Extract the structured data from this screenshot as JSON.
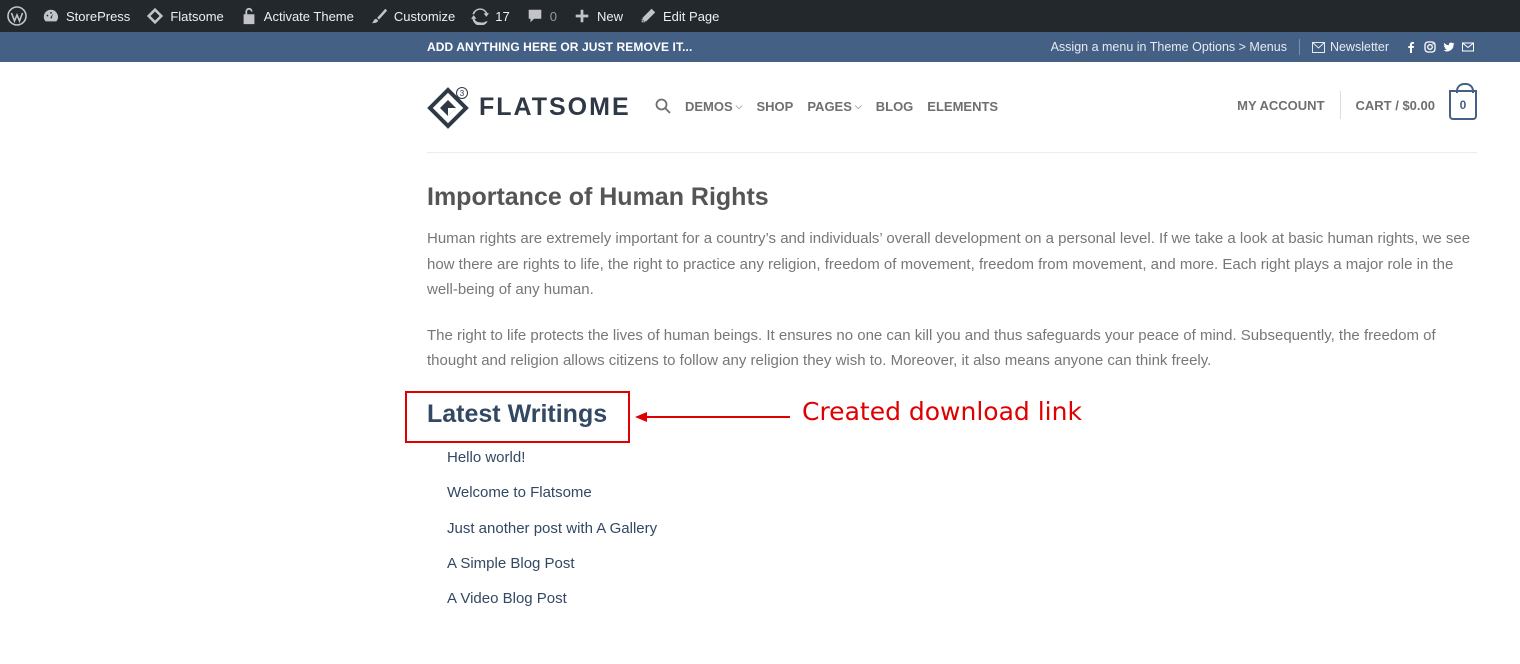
{
  "adminbar": {
    "site_name": "StorePress",
    "theme": "Flatsome",
    "activate": "Activate Theme",
    "customize": "Customize",
    "updates_count": "17",
    "comments_count": "0",
    "new": "New",
    "edit_page": "Edit Page"
  },
  "topbar": {
    "left_text": "ADD ANYTHING HERE OR JUST REMOVE IT...",
    "menu_hint": "Assign a menu in Theme Options > Menus",
    "newsletter": "Newsletter"
  },
  "header": {
    "logo_text": "FLATSOME",
    "logo_badge": "3",
    "nav": [
      {
        "label": "DEMOS",
        "dropdown": true
      },
      {
        "label": "SHOP",
        "dropdown": false
      },
      {
        "label": "PAGES",
        "dropdown": true
      },
      {
        "label": "BLOG",
        "dropdown": false
      },
      {
        "label": "ELEMENTS",
        "dropdown": false
      }
    ],
    "my_account": "MY ACCOUNT",
    "cart_label": "CART / $0.00",
    "cart_count": "0"
  },
  "content": {
    "title": "Importance of Human Rights",
    "paragraphs": [
      "Human rights are extremely important for a country’s and individuals’ overall development on a personal level. If we take a look at basic human rights, we see how there are rights to life, the right to practice any religion, freedom of movement, freedom from movement, and more. Each right plays a major role in the well-being of any human.",
      "The right to life protects the lives of human beings. It ensures no one can kill you and thus safeguards your peace of mind. Subsequently, the freedom of thought and religion allows citizens to follow any religion they wish to. Moreover, it also means anyone can think freely."
    ],
    "latest_title": "Latest Writings",
    "posts": [
      "Hello world!",
      "Welcome to Flatsome",
      "Just another post with A Gallery",
      "A Simple Blog Post",
      "A Video Blog Post"
    ]
  },
  "annotation": {
    "text": "Created download link",
    "color": "#e00000"
  },
  "colors": {
    "adminbar_bg": "#23282d",
    "topbar_bg": "#446084",
    "link": "#334862"
  }
}
